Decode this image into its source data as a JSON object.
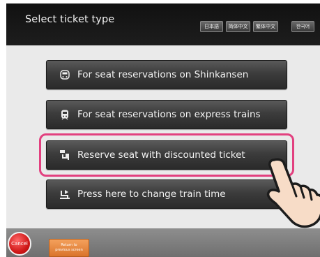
{
  "header": {
    "title": "Select ticket type",
    "languages": [
      "日本語",
      "简体中文",
      "繁体中文",
      "한국어"
    ]
  },
  "options": [
    {
      "label": "For seat reservations on Shinkansen",
      "icon": "shinkansen-train-icon"
    },
    {
      "label": "For seat reservations on express trains",
      "icon": "express-train-icon"
    },
    {
      "label": "Reserve seat with discounted ticket",
      "icon": "discount-seat-icon",
      "highlighted": true
    },
    {
      "label": "Press here to change train time",
      "icon": "change-time-icon"
    }
  ],
  "footer": {
    "cancel_label": "Cancel",
    "return_label_1": "Return to",
    "return_label_2": "previous screen"
  },
  "colors": {
    "highlight": "#e2407f",
    "cancel": "#d01818",
    "return": "#e68a42"
  }
}
